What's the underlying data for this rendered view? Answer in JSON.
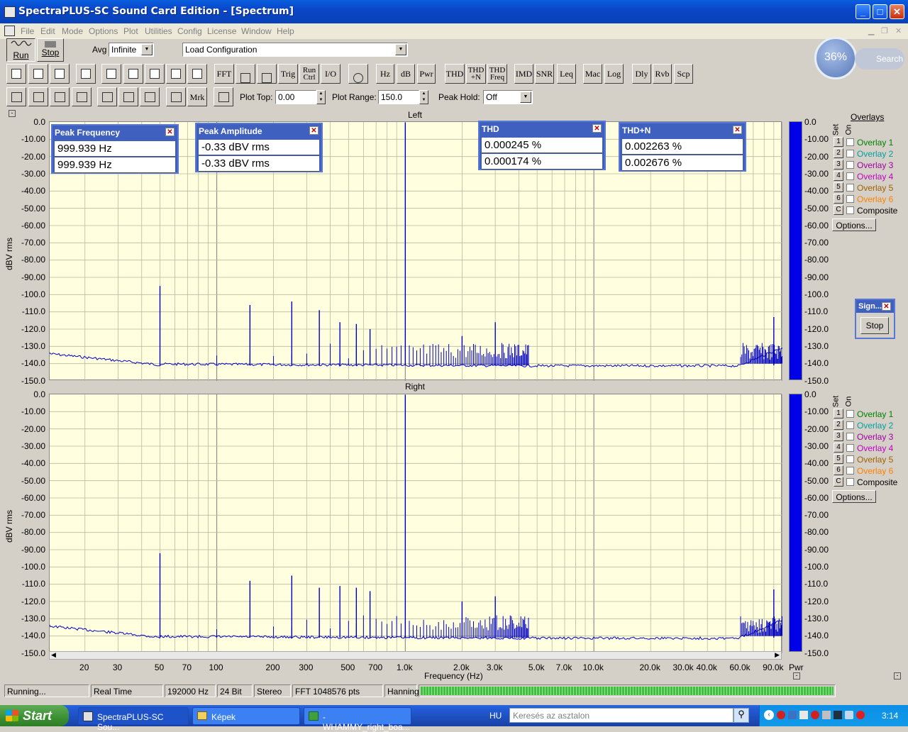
{
  "window": {
    "title": "SpectraPLUS-SC Sound Card Edition - [Spectrum]"
  },
  "menu": [
    "File",
    "Edit",
    "Mode",
    "Options",
    "Plot",
    "Utilities",
    "Config",
    "License",
    "Window",
    "Help"
  ],
  "toolbar1": {
    "run": "Run",
    "stop": "Stop",
    "avg_label": "Avg",
    "avg_value": "Infinite",
    "config_value": "Load Configuration"
  },
  "toolbar2": {
    "buttons": [
      "FFT",
      "Trig",
      "Run Ctrl",
      "I/O",
      "Hz",
      "dB",
      "Pwr",
      "THD",
      "THD +N",
      "THD Freq",
      "IMD",
      "SNR",
      "Leq",
      "Mac",
      "Log",
      "Dly",
      "Rvb",
      "Scp"
    ]
  },
  "toolbar3": {
    "mrk": "Mrk",
    "plot_top_label": "Plot Top:",
    "plot_top_value": "0.00",
    "plot_range_label": "Plot Range:",
    "plot_range_value": "150.0",
    "peak_hold_label": "Peak Hold:",
    "peak_hold_value": "Off"
  },
  "zoom": {
    "percent": "36%",
    "search": "Search"
  },
  "plots": {
    "left_title": "Left",
    "right_title": "Right",
    "ylabel": "dBV rms",
    "xlabel": "Frequency (Hz)",
    "yticks": [
      "0.0",
      "-10.00",
      "-20.00",
      "-30.00",
      "-40.00",
      "-50.00",
      "-60.00",
      "-70.00",
      "-80.00",
      "-90.00",
      "-100.0",
      "-110.0",
      "-120.0",
      "-130.0",
      "-140.0",
      "-150.0"
    ],
    "xticks": [
      "20",
      "30",
      "50",
      "70",
      "100",
      "200",
      "300",
      "500",
      "700",
      "1.0k",
      "2.0k",
      "3.0k",
      "5.0k",
      "7.0k",
      "10.0k",
      "20.0k",
      "30.0k",
      "40.0k",
      "60.0k",
      "90.0k"
    ],
    "pwr": "Pwr"
  },
  "overlays": {
    "header": "Overlays",
    "set": "Set",
    "on": "On",
    "items": [
      "Overlay 1",
      "Overlay 2",
      "Overlay 3",
      "Overlay 4",
      "Overlay 5",
      "Overlay 6",
      "Composite"
    ],
    "sets": [
      "1",
      "2",
      "3",
      "4",
      "5",
      "6",
      "C"
    ],
    "colors": [
      "#008000",
      "#00a0a0",
      "#a000a0",
      "#c000c0",
      "#a06000",
      "#ff8000",
      "#000000"
    ],
    "options": "Options..."
  },
  "meters": {
    "peak_freq": {
      "title": "Peak Frequency",
      "v1": "999.939 Hz",
      "v2": "999.939 Hz"
    },
    "peak_amp": {
      "title": "Peak Amplitude",
      "v1": "-0.33 dBV rms",
      "v2": "-0.33 dBV rms"
    },
    "thd": {
      "title": "THD",
      "v1": "0.000245 %",
      "v2": "0.000174 %"
    },
    "thdn": {
      "title": "THD+N",
      "v1": "0.002263 %",
      "v2": "0.002676 %"
    }
  },
  "siggen": {
    "title": "Sign...",
    "stop": "Stop"
  },
  "status": {
    "state": "Running...",
    "mode": "Real Time",
    "rate": "192000 Hz",
    "bits": "24 Bit",
    "channels": "Stereo",
    "fft": "FFT 1048576 pts",
    "window": "Hanning"
  },
  "taskbar": {
    "start": "Start",
    "tasks": [
      "SpectraPLUS-SC Sou...",
      "Képek",
      "-WHAMMY_right_boa..."
    ],
    "lang": "HU",
    "search_placeholder": "Keresés az asztalon",
    "clock": "3:14"
  },
  "chart_data": [
    {
      "type": "line",
      "title": "Left",
      "xlabel": "Frequency (Hz)",
      "ylabel": "dBV rms",
      "xscale": "log",
      "xlim": [
        13,
        100000
      ],
      "ylim": [
        -150,
        0
      ],
      "series": [
        {
          "values_note": "",
          "points": [
            [
              50,
              -95
            ],
            [
              150,
              -106
            ],
            [
              250,
              -104
            ],
            [
              350,
              -109
            ],
            [
              450,
              -116
            ],
            [
              550,
              -117
            ],
            [
              650,
              -120
            ],
            [
              1000,
              -0.33
            ],
            [
              2000,
              -124
            ],
            [
              3000,
              -116
            ],
            [
              90000,
              -113
            ]
          ]
        }
      ]
    },
    {
      "type": "line",
      "title": "Right",
      "xlabel": "Frequency (Hz)",
      "ylabel": "dBV rms",
      "xscale": "log",
      "xlim": [
        13,
        100000
      ],
      "ylim": [
        -150,
        0
      ],
      "series": [
        {
          "values_note": "",
          "points": [
            [
              50,
              -92
            ],
            [
              150,
              -108
            ],
            [
              250,
              -105
            ],
            [
              350,
              -112
            ],
            [
              450,
              -111
            ],
            [
              550,
              -112
            ],
            [
              650,
              -114
            ],
            [
              1000,
              -0.33
            ],
            [
              2000,
              -120
            ],
            [
              3000,
              -117
            ],
            [
              90000,
              -113
            ]
          ]
        }
      ]
    }
  ]
}
